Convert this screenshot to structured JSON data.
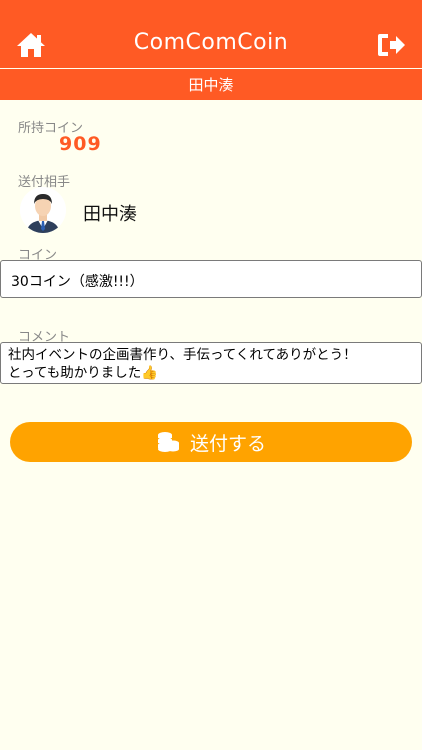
{
  "header": {
    "logo_text": "ComComCoin",
    "subtitle": "田中湊",
    "home_icon": "home-icon",
    "logout_icon": "logout-icon"
  },
  "balance": {
    "label": "所持コイン",
    "value": "909"
  },
  "recipient": {
    "label": "送付相手",
    "name": "田中湊",
    "avatar_icon": "avatar-icon"
  },
  "coin": {
    "label": "コイン",
    "value": "30コイン（感激!!!）"
  },
  "comment": {
    "label": "コメント",
    "value": "社内イベントの企画書作り、手伝ってくれてありがとう！\nとっても助かりました👍"
  },
  "send": {
    "label": "送付する",
    "icon": "coins-icon"
  },
  "colors": {
    "header": "#ff5a24",
    "accent": "#ff5a24",
    "button": "#ffa300",
    "background": "#fffff0"
  }
}
